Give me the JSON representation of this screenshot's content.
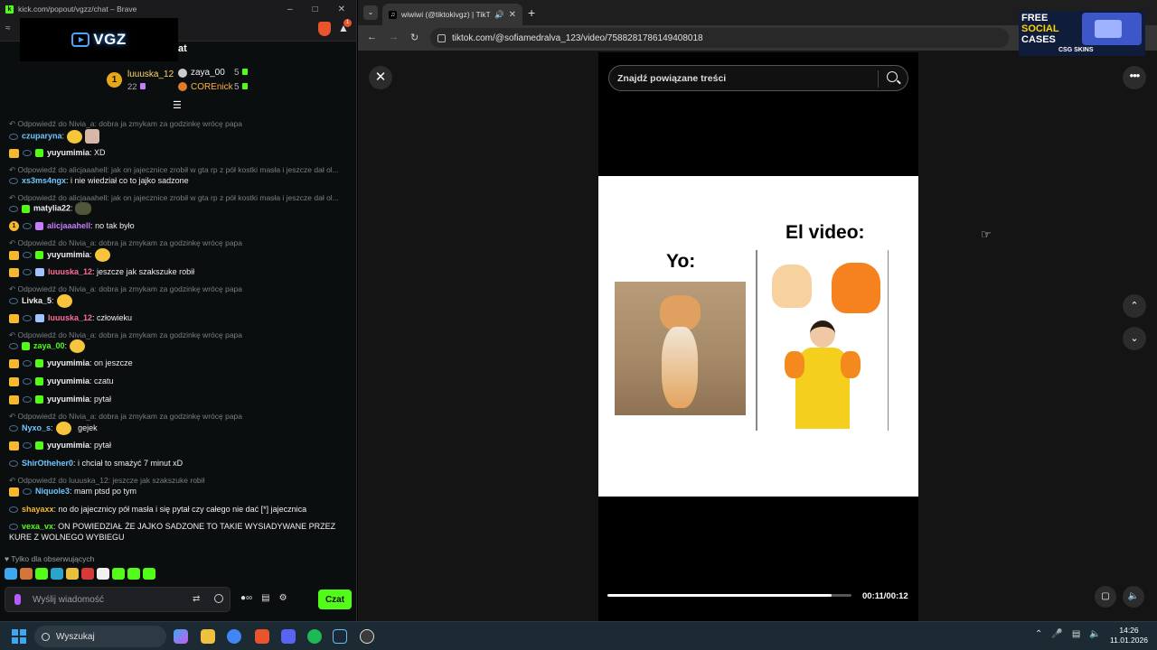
{
  "left_window": {
    "title": "kick.com/popout/vgzz/chat – Brave",
    "logo_text": "VGZ",
    "header_fragment": "at",
    "leaderboard": [
      {
        "name": "luuuska_12",
        "count": "22",
        "rank": "1"
      },
      {
        "name": "zaya_00",
        "count": "5"
      },
      {
        "name": "COREnick",
        "count": "5"
      }
    ],
    "messages": [
      {
        "reply": "Odpowiedź do Nivia_a: dobra ja zmykam za godzinkę wrócę papa"
      },
      {
        "user": "czuparyna",
        "color": "#6fc7ff",
        "text": "",
        "badges": "ring",
        "emote": "yellow+pink"
      },
      {
        "user": "yuyumimia",
        "color": "#ffffff",
        "text": "XD",
        "badges": "crown ring sub"
      },
      {
        "reply": "Odpowiedź do alicjaaahell: jak on jajecznice zrobił w gta rp z pół kostki masła i jeszcze dał ol..."
      },
      {
        "user": "xs3ms4ngx",
        "color": "#6fc7ff",
        "text": "i nie wiedział co to jajko sadzone",
        "badges": "ring"
      },
      {
        "reply": "Odpowiedź do alicjaaahell: jak on jajecznice zrobił w gta rp z pół kostki masła i jeszcze dał ol..."
      },
      {
        "user": "matylia22",
        "color": "#ffffff",
        "text": "",
        "badges": "ring sub",
        "emote": "dark"
      },
      {
        "user": "alicjaaahell",
        "color": "#c77dff",
        "text": "no tak było",
        "badges": "num ring subp"
      },
      {
        "reply": "Odpowiedź do Nivia_a: dobra ja zmykam za godzinkę wrócę papa"
      },
      {
        "user": "yuyumimia",
        "color": "#ffffff",
        "text": "",
        "badges": "crown ring sub",
        "emote": "yellow"
      },
      {
        "user": "luuuska_12",
        "color": "#ff6b9a",
        "text": "jeszcze jak szakszuke robił",
        "badges": "crown ring subb"
      },
      {
        "reply": "Odpowiedź do Nivia_a: dobra ja zmykam za godzinkę wrócę papa"
      },
      {
        "user": "Livka_5",
        "color": "#ffffff",
        "text": "",
        "badges": "ring",
        "emote": "yellow"
      },
      {
        "user": "luuuska_12",
        "color": "#ff6b9a",
        "text": "człowieku",
        "badges": "crown ring subb"
      },
      {
        "reply": "Odpowiedź do Nivia_a: dobra ja zmykam za godzinkę wrócę papa"
      },
      {
        "user": "zaya_00",
        "color": "#53fc18",
        "text": "",
        "badges": "ring sub",
        "emote": "yellow"
      },
      {
        "user": "yuyumimia",
        "color": "#ffffff",
        "text": "on jeszcze",
        "badges": "crown ring sub"
      },
      {
        "user": "yuyumimia",
        "color": "#ffffff",
        "text": "czatu",
        "badges": "crown ring sub"
      },
      {
        "user": "yuyumimia",
        "color": "#ffffff",
        "text": "pytał",
        "badges": "crown ring sub"
      },
      {
        "reply": "Odpowiedź do Nivia_a: dobra ja zmykam za godzinkę wrócę papa"
      },
      {
        "user": "Nyxo_s",
        "color": "#6fc7ff",
        "text": "gejek",
        "badges": "ring",
        "emote": "yellow"
      },
      {
        "user": "yuyumimia",
        "color": "#ffffff",
        "text": "pytał",
        "badges": "crown ring sub"
      },
      {
        "user": "ShirOtheher0",
        "color": "#6fc7ff",
        "text": "i chciał to smażyć 7 minut xD",
        "badges": "ring"
      },
      {
        "reply": "Odpowiedź do luuuska_12: jeszcze jak szakszuke robił"
      },
      {
        "user": "Niquole3",
        "color": "#6fc7ff",
        "text": "mam ptsd po tym",
        "badges": "crown ring"
      },
      {
        "user": "shayaxx",
        "color": "#f5b82e",
        "text": "no do jajecznicy pół masła i się pytał czy całego nie dać [*] jajecznica",
        "badges": "ring"
      },
      {
        "user": "vexa_vx",
        "color": "#53fc18",
        "text": "ON POWIEDZIAŁ ŻE JAJKO SADZONE TO TAKIE WYSIADYWANE PRZEZ",
        "text2": "KURE Z WOLNEGO WYBIEGU",
        "badges": "ring"
      }
    ],
    "followers_only": "Tylko dla obserwujących",
    "input_placeholder": "Wyślij wiadomość",
    "send_label": "Czat"
  },
  "right_window": {
    "tab_title": "wiwiwi (@tiktokivgz) | TikTo",
    "url": "tiktok.com/@sofiamedralva_123/video/7588281786149408018",
    "ad": {
      "line1": "FREE",
      "line2": "SOCIAL",
      "line3": "CASES",
      "brand": "CSG SKINS"
    },
    "search_placeholder": "Znajdź powiązane treści",
    "video": {
      "left_caption": "Yo:",
      "right_caption": "El video:",
      "time": "00:11/00:12",
      "progress": 0.917
    }
  },
  "taskbar": {
    "search_label": "Wyszukaj",
    "time": "14:26",
    "date": "11.01.2026"
  },
  "colors": {
    "kick_green": "#53fc18",
    "accent_purple": "#b65cff"
  }
}
